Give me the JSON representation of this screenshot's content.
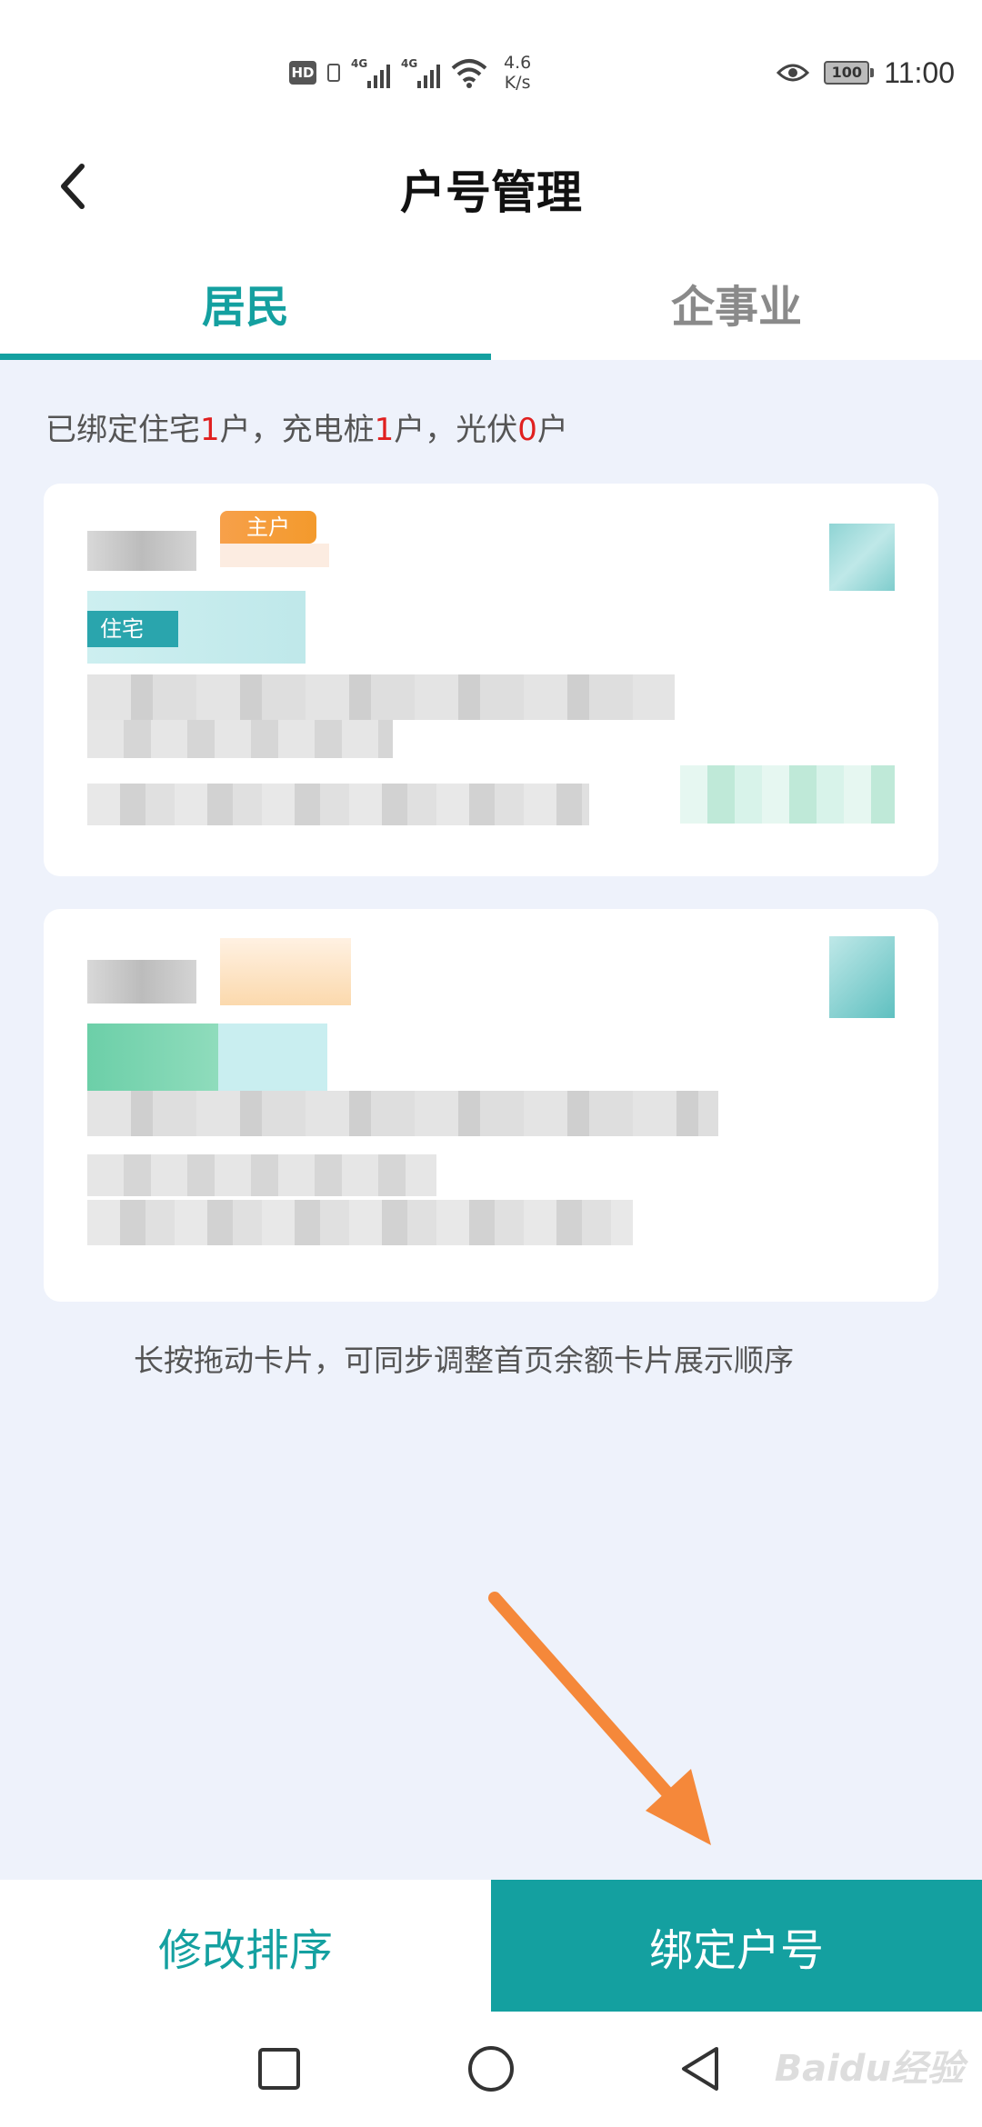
{
  "status_bar": {
    "hd": "HD",
    "sig1": "4G",
    "sig2": "4G",
    "speed_value": "4.6",
    "speed_unit": "K/s",
    "battery": "100",
    "time": "11:00"
  },
  "header": {
    "title": "户号管理"
  },
  "tabs": [
    {
      "label": "居民",
      "active": true
    },
    {
      "label": "企事业",
      "active": false
    }
  ],
  "summary": {
    "prefix": "已绑定住宅",
    "residence_count": "1",
    "part2": "户，充电桩",
    "charging_count": "1",
    "part3": "户，光伏",
    "solar_count": "0",
    "suffix": "户",
    "sep_after_first": "户，"
  },
  "cards": [
    {
      "badge": "主户",
      "type_tag": "住宅"
    },
    {
      "badge": "",
      "type_tag": ""
    }
  ],
  "hint": "长按拖动卡片，可同步调整首页余额卡片展示顺序",
  "bottom_bar": {
    "sort_label": "修改排序",
    "bind_label": "绑定户号"
  },
  "watermark": "Baidu经验",
  "colors": {
    "accent": "#14a0a0",
    "highlight_number": "#e02020",
    "badge": "#f39a2c",
    "arrow": "#f5883a"
  }
}
